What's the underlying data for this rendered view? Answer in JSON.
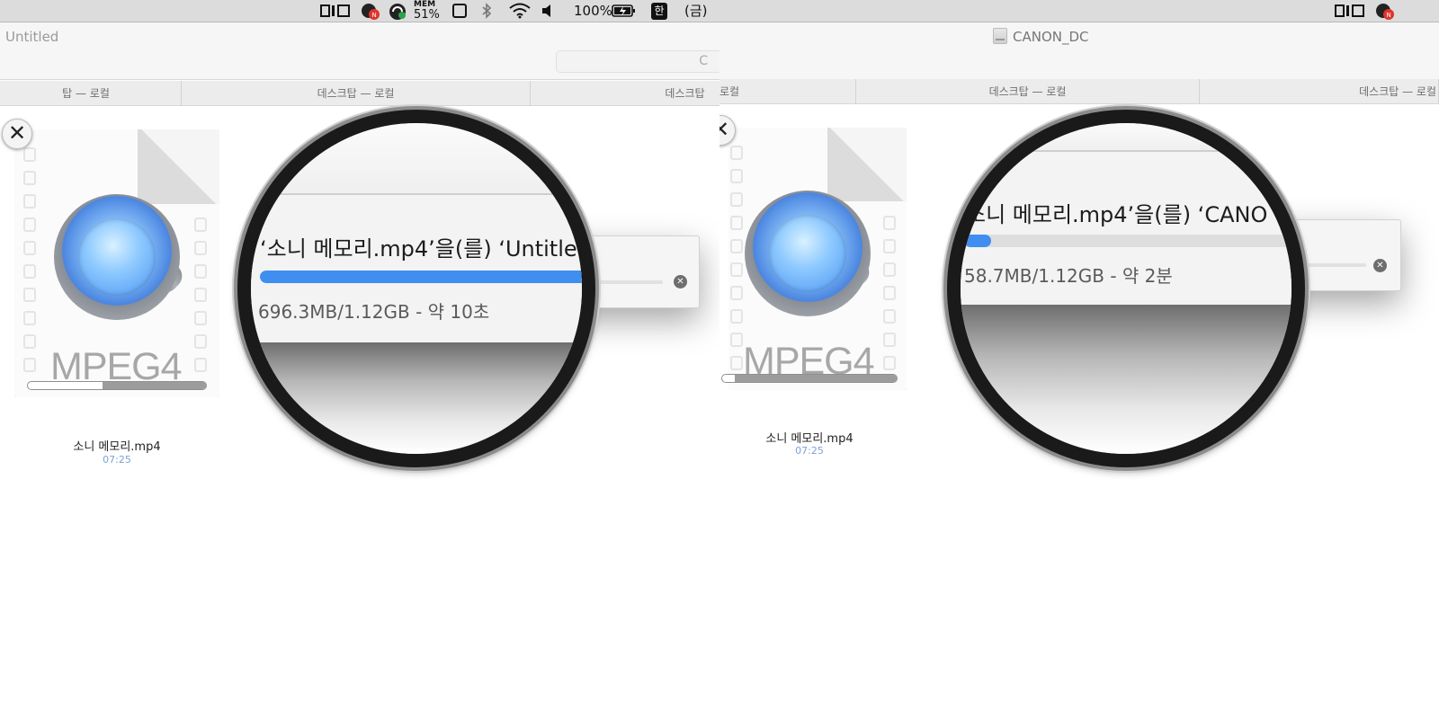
{
  "left": {
    "menubar": {
      "mem_label": "MEM",
      "mem_pct": "51%",
      "battery": "100%",
      "input_method": "한",
      "day": "(금)"
    },
    "window_title": "Untitled",
    "search_text": "C",
    "tabs": [
      "탑 — 로컬",
      "데스크탑 — 로컬",
      "데스크탑"
    ],
    "file": {
      "icon_label": "MPEG4",
      "name": "소니 메모리.mp4",
      "time": "07:25",
      "progress_pct": 58
    },
    "lens": {
      "title": "‘소니 메모리.mp4’을(를) ‘Untitled",
      "status": "696.3MB/1.12GB - 약 10초",
      "progress_pct": 99
    }
  },
  "right": {
    "window_title": "CANON_DC",
    "tabs": [
      "로컬",
      "데스크탑 — 로컬",
      "데스크탑 — 로컬"
    ],
    "file": {
      "icon_label": "MPEG4",
      "name": "소니 메모리.mp4",
      "time": "07:25",
      "progress_pct": 7
    },
    "lens": {
      "title": "소니 메모리.mp4’을(를) ‘CANO",
      "status": "58.7MB/1.12GB - 약 2분",
      "progress_pct": 8
    }
  },
  "colors": {
    "accent": "#3f8ef0",
    "time_text": "#7ba3d6"
  }
}
